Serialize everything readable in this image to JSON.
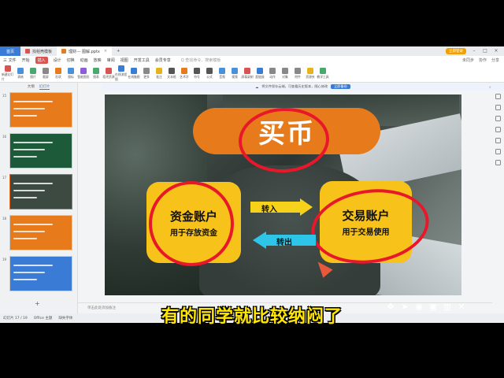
{
  "titlebar": {
    "home_label": "首页",
    "tabs": [
      {
        "label": "找稻壳模板",
        "color": "#d9534f"
      },
      {
        "label": "理财--- 图解.pptx",
        "color": "#e77a1b"
      }
    ],
    "login_label": "立即登录"
  },
  "menubar": {
    "items": [
      "三 文件",
      "开始",
      "插入",
      "设计",
      "切换",
      "动画",
      "放映",
      "审阅",
      "视图",
      "开发工具",
      "会员专享"
    ],
    "active_index": 2,
    "search_placeholder": "Q 查找命令、搜索模板",
    "right_items": [
      "未同步",
      "协作",
      "分享"
    ]
  },
  "ribbon": {
    "items": [
      {
        "label": "新建幻灯片",
        "color": "#d9534f"
      },
      {
        "label": "表格",
        "color": "#4a90d9"
      },
      {
        "label": "图片",
        "color": "#4aa86e"
      },
      {
        "label": "截屏",
        "color": "#888888"
      },
      {
        "label": "形状",
        "color": "#e77a1b"
      },
      {
        "label": "图标",
        "color": "#4a90d9"
      },
      {
        "label": "智能图形",
        "color": "#8e5bd9"
      },
      {
        "label": "图表",
        "color": "#4aa86e"
      },
      {
        "label": "稻壳资源",
        "color": "#d9534f"
      },
      {
        "label": "在线流程图",
        "color": "#3a7bd5"
      },
      {
        "label": "在线脑图",
        "color": "#3a7bd5"
      },
      {
        "label": "更多",
        "color": "#888888"
      },
      {
        "label": "批注",
        "color": "#e7b31b"
      },
      {
        "label": "文本框",
        "color": "#555555"
      },
      {
        "label": "艺术字",
        "color": "#e77a1b"
      },
      {
        "label": "符号",
        "color": "#555555"
      },
      {
        "label": "公式",
        "color": "#555555"
      },
      {
        "label": "音频",
        "color": "#4a90d9"
      },
      {
        "label": "视频",
        "color": "#4a90d9"
      },
      {
        "label": "屏幕录制",
        "color": "#d9534f"
      },
      {
        "label": "超链接",
        "color": "#3a7bd5"
      },
      {
        "label": "动作",
        "color": "#888888"
      },
      {
        "label": "对象",
        "color": "#888888"
      },
      {
        "label": "附件",
        "color": "#888888"
      },
      {
        "label": "资源夹",
        "color": "#e7b31b"
      },
      {
        "label": "教学工具",
        "color": "#4aa86e"
      }
    ]
  },
  "notice": {
    "text": "将文件保存云端，可查看历史版本，随心修改",
    "button": "立即备份"
  },
  "leftpanel": {
    "tabs": [
      "大纲",
      "幻灯片"
    ],
    "slides": [
      {
        "num": "15",
        "bg": "#e77a1b"
      },
      {
        "num": "16",
        "bg": "#1d5a3a"
      },
      {
        "num": "17",
        "bg": "#3d4a42"
      },
      {
        "num": "18",
        "bg": "#e77a1b"
      },
      {
        "num": "19",
        "bg": "#3a7bd5"
      }
    ],
    "selected_index": 2,
    "add_label": "+"
  },
  "slide": {
    "title": "买币",
    "left_box": {
      "line1": "资金账户",
      "line2": "用于存放资金"
    },
    "right_box": {
      "line1": "交易账户",
      "line2": "用于交易使用"
    },
    "arrow_in_label": "转入",
    "arrow_out_label": "转出"
  },
  "notes_placeholder": "单击此处添加备注",
  "statusbar": {
    "slide_counter": "幻灯片 17 / 19",
    "theme": "Office 主题",
    "font_missing": "缺失字体"
  },
  "subtitle": "有的同学就比较纳闷了",
  "overlay_icons": [
    "move-icon",
    "cursor-icon",
    "eye-icon",
    "camera-icon",
    "trash-icon",
    "close-icon"
  ],
  "colors": {
    "accent_orange": "#e77a1b",
    "box_yellow": "#f7c21a",
    "red_circle": "#e8182a",
    "arrow_cyan": "#2ec6e8",
    "subtitle_yellow": "#ffe600"
  }
}
